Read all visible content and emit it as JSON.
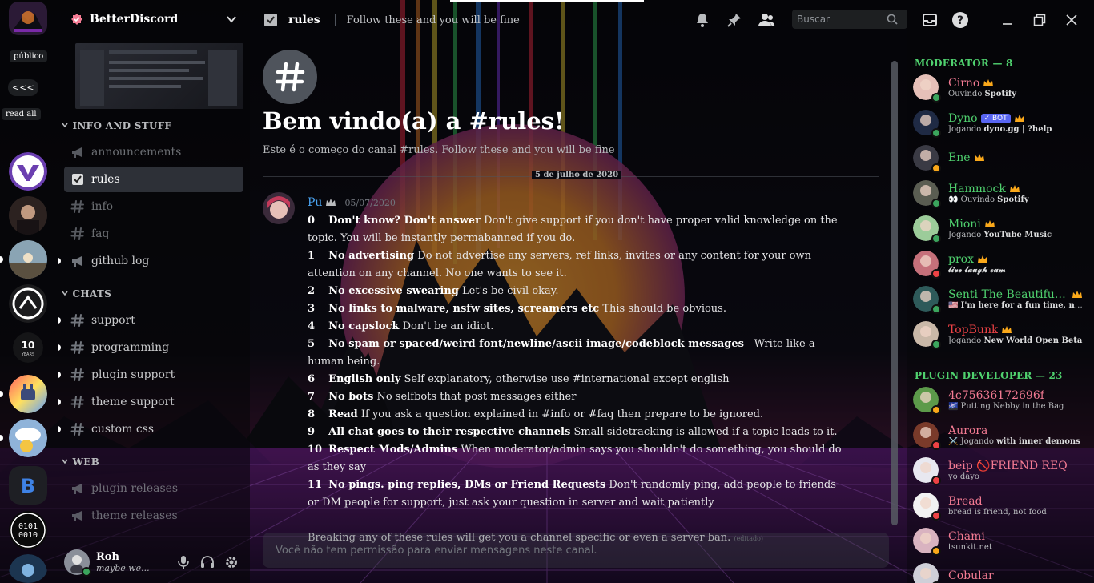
{
  "window": {
    "guild_name": "BetterDiscord",
    "channel_name": "rules",
    "topic": "Follow these and you will be fine",
    "search_placeholder": "Buscar"
  },
  "rail": {
    "public_label": "público",
    "collapse_label": "<<<",
    "read_all_label": "read all",
    "anniversary_label": "10",
    "anniversary_sub": "YEARS",
    "binary_label": [
      "0101",
      "0010"
    ]
  },
  "sidebar": {
    "categories": [
      {
        "name": "INFO AND STUFF",
        "channels": [
          {
            "name": "announcements",
            "icon": "megaphone-icon",
            "state": "muted"
          },
          {
            "name": "rules",
            "icon": "rules-icon",
            "state": "active"
          },
          {
            "name": "info",
            "icon": "hash-icon",
            "state": "muted"
          },
          {
            "name": "faq",
            "icon": "hash-icon",
            "state": "muted"
          },
          {
            "name": "github log",
            "icon": "megaphone-icon",
            "state": "unread"
          }
        ]
      },
      {
        "name": "CHATS",
        "channels": [
          {
            "name": "support",
            "icon": "hash-icon",
            "state": "unread"
          },
          {
            "name": "programming",
            "icon": "hash-icon",
            "state": "unread"
          },
          {
            "name": "plugin support",
            "icon": "hash-icon",
            "state": "unread"
          },
          {
            "name": "theme support",
            "icon": "hash-icon",
            "state": "unread"
          },
          {
            "name": "custom css",
            "icon": "hash-icon",
            "state": "unread"
          }
        ]
      },
      {
        "name": "WEB",
        "channels": [
          {
            "name": "plugin releases",
            "icon": "megaphone-icon",
            "state": "muted"
          },
          {
            "name": "theme releases",
            "icon": "megaphone-icon",
            "state": "muted"
          }
        ]
      }
    ]
  },
  "user": {
    "name": "Roh",
    "status": "maybe we..."
  },
  "chat": {
    "welcome_title": "Bem vindo(a) a #rules!",
    "welcome_sub": "Este é o começo do canal #rules. Follow these and you will be fine",
    "date_divider": "5 de julho de 2020",
    "message": {
      "author": "Pu",
      "timestamp": "05/07/2020",
      "rules": [
        {
          "n": "0",
          "title": "Don't know? Don't answer",
          "text": " Don't give support if you don't have proper valid knowledge on the topic. You will be instantly permabanned if you do."
        },
        {
          "n": "1",
          "title": "No advertising",
          "text": " Do not advertise any servers, ref links, invites or any content for your own attention on any channel. No one wants to see it."
        },
        {
          "n": "2",
          "title": "No excessive swearing",
          "text": " Let's be civil okay."
        },
        {
          "n": "3",
          "title": "No links to malware, nsfw sites, screamers etc",
          "text": " This should be obvious."
        },
        {
          "n": "4",
          "title": "No capslock",
          "text": " Don't be an idiot."
        },
        {
          "n": "5",
          "title": "No spam or spaced/weird font/newline/ascii image/codeblock messages",
          "text": " - Write like a human being."
        },
        {
          "n": "6",
          "title": "English only",
          "text": " Self explanatory, otherwise use #international except english"
        },
        {
          "n": "7",
          "title": "No bots",
          "text": " No selfbots that post messages either"
        },
        {
          "n": "8",
          "title": "Read",
          "text": " If you ask a question explained in #info or #faq then prepare to be ignored."
        },
        {
          "n": "9",
          "title": "All chat goes to their respective channels",
          "text": " Small sidetracking is allowed if a topic leads to it."
        },
        {
          "n": "10",
          "title": "Respect Mods/Admins",
          "text": " When moderator/admin says you shouldn't do something, you should do as they say"
        },
        {
          "n": "11",
          "title": "No pings. ping replies, DMs or Friend Requests",
          "text": " Don't randomly ping, add people to friends or DM people for support, just ask your question in server and wait patiently"
        }
      ],
      "footer": "Breaking any of these rules will get you a channel specific or even a server ban.",
      "edited": "(editado)"
    },
    "input_placeholder": "Você não tem permissão para enviar mensagens neste canal."
  },
  "members": {
    "groups": [
      {
        "role": "MODERATOR — 8",
        "list": [
          {
            "name": "Cirno",
            "color": "#f47b93",
            "crown": true,
            "activity_prefix": "Ouvindo ",
            "activity": "Spotify",
            "status": "online",
            "avatar": "#e6c0b8"
          },
          {
            "name": "Dyno",
            "color": "#4fd06e",
            "bot": true,
            "bot_label": "✓ BOT",
            "crown": true,
            "activity_prefix": "Jogando ",
            "activity": "dyno.gg | ?help",
            "status": "online",
            "avatar": "#1f2a44"
          },
          {
            "name": "Ene",
            "color": "#4fd06e",
            "crown": true,
            "activity_prefix": "",
            "activity": "",
            "status": "idle",
            "avatar": "#3a3a44"
          },
          {
            "name": "Hammock",
            "color": "#4fd06e",
            "crown": true,
            "activity_prefix": "👀 Ouvindo ",
            "activity": "Spotify",
            "status": "online",
            "avatar": "#5a5d52"
          },
          {
            "name": "Mioni",
            "color": "#4fd06e",
            "crown": true,
            "activity_prefix": "Jogando ",
            "activity": "YouTube Music",
            "status": "online",
            "avatar": "#9ccc9a"
          },
          {
            "name": "prox",
            "color": "#4fd06e",
            "crown": true,
            "activity_prefix": "",
            "activity": "𝓵𝓲𝓿𝓮 𝓵𝓪𝓾𝓰𝓱 𝓬𝓾𝓶",
            "status": "dnd",
            "avatar": "#c5707a"
          },
          {
            "name": "Senti The Beautiful Sh...",
            "color": "#4fd06e",
            "crown": true,
            "activity_prefix": "🇺🇸 ",
            "activity": "I'm here for a fun time, not a l...",
            "status": "online",
            "avatar": "#2e5a5a"
          },
          {
            "name": "TopBunk",
            "color": "#ed4245",
            "crown": true,
            "activity_prefix": "Jogando ",
            "activity": "New World Open Beta",
            "status": "online",
            "avatar": "#c9b8a8"
          }
        ]
      },
      {
        "role": "PLUGIN DEVELOPER — 23",
        "list": [
          {
            "name": "4c75636172696f",
            "color": "#f47b93",
            "crown": false,
            "activity_prefix": "🌌 Putting Nebby in the Bag",
            "activity": "",
            "status": "idle",
            "avatar": "#5c9a4a"
          },
          {
            "name": "Aurora",
            "color": "#f47b93",
            "crown": false,
            "activity_prefix": "⚔️ Jogando ",
            "activity": "with inner demons",
            "status": "dnd",
            "avatar": "#7a3a2a"
          },
          {
            "name": "beip 🚫FRIEND REQ",
            "color": "#f47b93",
            "crown": false,
            "activity_prefix": "yo dayo",
            "activity": "",
            "status": "dnd",
            "avatar": "#e8e8f0"
          },
          {
            "name": "Bread",
            "color": "#f47b93",
            "crown": false,
            "activity_prefix": "bread is friend, not food",
            "activity": "",
            "status": "dnd",
            "avatar": "#f2f2f2"
          },
          {
            "name": "Chami",
            "color": "#f47b93",
            "crown": false,
            "activity_prefix": "tsunkit.net",
            "activity": "",
            "status": "idle",
            "avatar": "#d9b3c0"
          },
          {
            "name": "Cobular",
            "color": "#f47b93",
            "crown": false,
            "activity_prefix": "",
            "activity": "",
            "status": "online",
            "avatar": "#cfcfd8"
          }
        ]
      }
    ]
  },
  "colors": {
    "accent": "#5865f2",
    "role_header": "#4fd06e",
    "author": "#4aa3f0"
  }
}
